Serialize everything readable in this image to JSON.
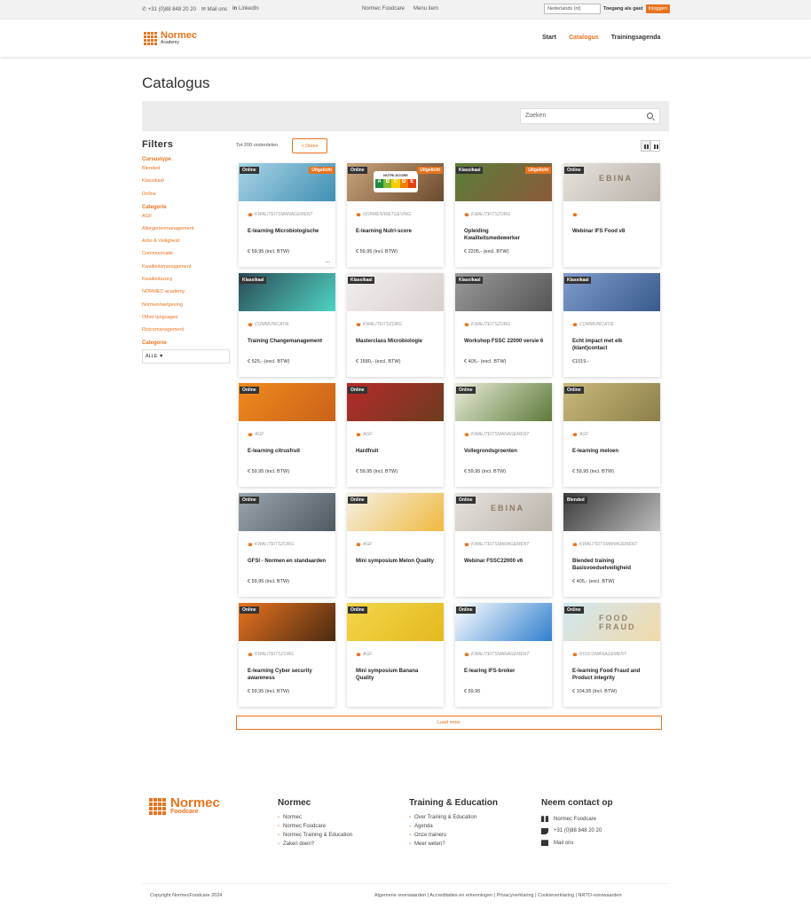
{
  "topbar": {
    "phone": "+31 (0)88 848 20 20",
    "mail": "Mail ons",
    "linkedin": "LinkedIn",
    "center_links": [
      "Normec Foodcare",
      "Menu item"
    ],
    "language": "Nederlands (nl)",
    "guest": "Toegang als gast",
    "login": "Inloggen"
  },
  "header": {
    "logo_name": "Normec",
    "logo_sub": "Academy",
    "nav": [
      {
        "label": "Start",
        "active": false
      },
      {
        "label": "Catalogus",
        "active": true
      },
      {
        "label": "Trainingsagenda",
        "active": false
      }
    ]
  },
  "page": {
    "title": "Catalogus",
    "search_placeholder": "Zoeken",
    "count": "Tot 200 onderdelen",
    "share": "Delen",
    "load_more": "Laad meer"
  },
  "filters": {
    "title": "Filters",
    "groups": [
      {
        "title": "Cursustype",
        "items": [
          "Blended",
          "Klassikaal",
          "Online"
        ]
      },
      {
        "title": "Categorie",
        "items": [
          "AGF",
          "Allergenenmanagement",
          "Arbo & Veiligheid",
          "Communicatie",
          "Kwaliteitsmanagement",
          "Kwaliteitszorg",
          "NORMEC academy",
          "Normen/wetgeving",
          "Other languages",
          "Risicomanagement"
        ]
      }
    ],
    "select_title": "Categorie",
    "select_value": "ALLE"
  },
  "cards": [
    {
      "type": "Online",
      "extra": "Uitgelicht",
      "category": "KWALITEITSMANAGEMENT",
      "title": "E-learning Microbiologische",
      "price": "€ 59,95 (incl. BTW)",
      "dots": "..."
    },
    {
      "type": "Online",
      "extra": "Uitgelicht",
      "category": "NORMEN/WETGEVING",
      "title": "E-learning Nutri-score",
      "price": "€ 59,95 (incl. BTW)"
    },
    {
      "type": "Klassikaal",
      "extra": "Uitgelicht",
      "category": "KWALITEITSZORG",
      "title": "Opleiding Kwaliteitsmedewerker",
      "price": "€ 2205,- (excl. BTW)"
    },
    {
      "type": "Online",
      "extra": "",
      "category": "-",
      "title": "Webinar IFS Food v8",
      "price": ""
    },
    {
      "type": "Klassikaal",
      "extra": "",
      "category": "COMMUNICATIE",
      "title": "Training Changemanagement",
      "price": "€ 525,- (excl. BTW)"
    },
    {
      "type": "Klassikaal",
      "extra": "",
      "category": "KWALITEITSZORG",
      "title": "Masterclass Microbiologie",
      "price": "€ 1580,- (excl. BTW)"
    },
    {
      "type": "Klassikaal",
      "extra": "",
      "category": "KWALITEITSZORG",
      "title": "Workshop FSSC 22000 versie 6",
      "price": "€ 405,- (excl. BTW)"
    },
    {
      "type": "Klassikaal",
      "extra": "",
      "category": "COMMUNICATIE",
      "title": "Echt impact met elk (klant)contact",
      "price": "€1019,-"
    },
    {
      "type": "Online",
      "extra": "",
      "category": "AGF",
      "title": "E-learning citrusfruit",
      "price": "€ 59,95 (incl. BTW)"
    },
    {
      "type": "Online",
      "extra": "",
      "category": "AGF",
      "title": "Hardfruit",
      "price": "€ 59,95 (incl. BTW)"
    },
    {
      "type": "Online",
      "extra": "",
      "category": "KWALITEITSMANAGEMENT",
      "title": "Vollegrondsgroenten",
      "price": "€ 59,95 (incl. BTW)"
    },
    {
      "type": "Online",
      "extra": "",
      "category": "AGF",
      "title": "E-learning meloen",
      "price": "€ 59,95 (incl. BTW)"
    },
    {
      "type": "Online",
      "extra": "",
      "category": "KWALITEITSZORG",
      "title": "GFSI - Normen en standaarden",
      "price": "€ 59,95 (incl. BTW)"
    },
    {
      "type": "Online",
      "extra": "",
      "category": "AGF",
      "title": "Mini symposium Melon Quality",
      "price": ""
    },
    {
      "type": "Online",
      "extra": "",
      "category": "KWALITEITSMANAGEMENT",
      "title": "Webinar FSSC22000 v6",
      "price": ""
    },
    {
      "type": "Blended",
      "extra": "",
      "category": "KWALITEITSMANAGEMENT",
      "title": "Blended training Basisvoedselveiligheid",
      "price": "€ 405,- (excl. BTW)"
    },
    {
      "type": "Online",
      "extra": "",
      "category": "KWALITEITSZORG",
      "title": "E-learning Cyber security awareness",
      "price": "€ 59,95 (incl. BTW)"
    },
    {
      "type": "Online",
      "extra": "",
      "category": "AGF",
      "title": "Mini symposium Banana Quality",
      "price": ""
    },
    {
      "type": "Online",
      "extra": "",
      "category": "KWALITEITSMANAGEMENT",
      "title": "E-learing IFS-broker",
      "price": "€ 59,95"
    },
    {
      "type": "Online",
      "extra": "",
      "category": "RISICOMANAGEMENT",
      "title": "E-learning Food Fraud and Product integrity",
      "price": "€ 104,95 (incl. BTW)"
    }
  ],
  "card_images": [
    {
      "name": "microscope-image",
      "colors": [
        "#a9d4e6",
        "#3f8fb3"
      ]
    },
    {
      "name": "nutri-score-image",
      "colors": [
        "#c9a57b",
        "#6b4a2f"
      ],
      "label": "NUTRI-SCORE",
      "letters": [
        "A",
        "B",
        "C",
        "D",
        "E"
      ]
    },
    {
      "name": "building-image",
      "colors": [
        "#5a7d3a",
        "#8c5a3a"
      ]
    },
    {
      "name": "laptop-image",
      "colors": [
        "#e6e2dc",
        "#b9b3ab"
      ],
      "label": "EBINA"
    },
    {
      "name": "hologram-image",
      "colors": [
        "#2b4a55",
        "#4fd3c3"
      ]
    },
    {
      "name": "lab-hands-image",
      "colors": [
        "#f2efee",
        "#d8cfcc"
      ]
    },
    {
      "name": "classroom-image",
      "colors": [
        "#9a9a9a",
        "#555555"
      ]
    },
    {
      "name": "network-image",
      "colors": [
        "#7f9ccc",
        "#3a5a8c"
      ]
    },
    {
      "name": "mandarins-image",
      "colors": [
        "#f08a1c",
        "#c9621a"
      ]
    },
    {
      "name": "apples-image",
      "colors": [
        "#b52a2a",
        "#6d3c1f"
      ]
    },
    {
      "name": "cauliflower-image",
      "colors": [
        "#e8ecd8",
        "#5d7a3a"
      ]
    },
    {
      "name": "melons-image",
      "colors": [
        "#c9b97a",
        "#8c7f4a"
      ]
    },
    {
      "name": "factory-image",
      "colors": [
        "#9aa6ad",
        "#4e5a61"
      ]
    },
    {
      "name": "melon-slices-image",
      "colors": [
        "#f4f1e4",
        "#f0b940"
      ]
    },
    {
      "name": "laptop-image-2",
      "colors": [
        "#e6e2dc",
        "#b9b3ab"
      ],
      "label": "EBINA"
    },
    {
      "name": "training-room-image",
      "colors": [
        "#3a3a3a",
        "#bdbdbd"
      ]
    },
    {
      "name": "cyber-lock-image",
      "colors": [
        "#e8731f",
        "#4a2a12"
      ]
    },
    {
      "name": "bananas-image",
      "colors": [
        "#f3d64a",
        "#e3b91e"
      ]
    },
    {
      "name": "world-map-image",
      "colors": [
        "#ffffff",
        "#2f7fcf"
      ]
    },
    {
      "name": "food-fraud-image",
      "colors": [
        "#cfe7f3",
        "#f2d9a8"
      ],
      "label": "FOOD FRAUD"
    }
  ],
  "footer": {
    "logo_name": "Normec",
    "logo_sub": "Foodcare",
    "columns": [
      {
        "title": "Normec",
        "items": [
          "Normec",
          "Normec Foodcare",
          "Normec Training & Education",
          "Zaken doen?"
        ]
      },
      {
        "title": "Training & Education",
        "items": [
          "Over Training & Education",
          "Agenda",
          "Onze trainers",
          "Meer weten?"
        ]
      }
    ],
    "contact": {
      "title": "Neem contact op",
      "company": "Normec Foodcare",
      "phone": "+31 (0)88 848 20 20",
      "mail": "Mail ons"
    },
    "copyright": "Copyright NormecFoodcare 2024",
    "legal": "Algemene voorwaarden | Accreditaties en erkenningen | Privacyverklaring | Cookieverklaring | NRTO-voorwaarden"
  },
  "colors": {
    "accent": "#e8731f",
    "badge": "#333333",
    "band": "#ececec"
  }
}
